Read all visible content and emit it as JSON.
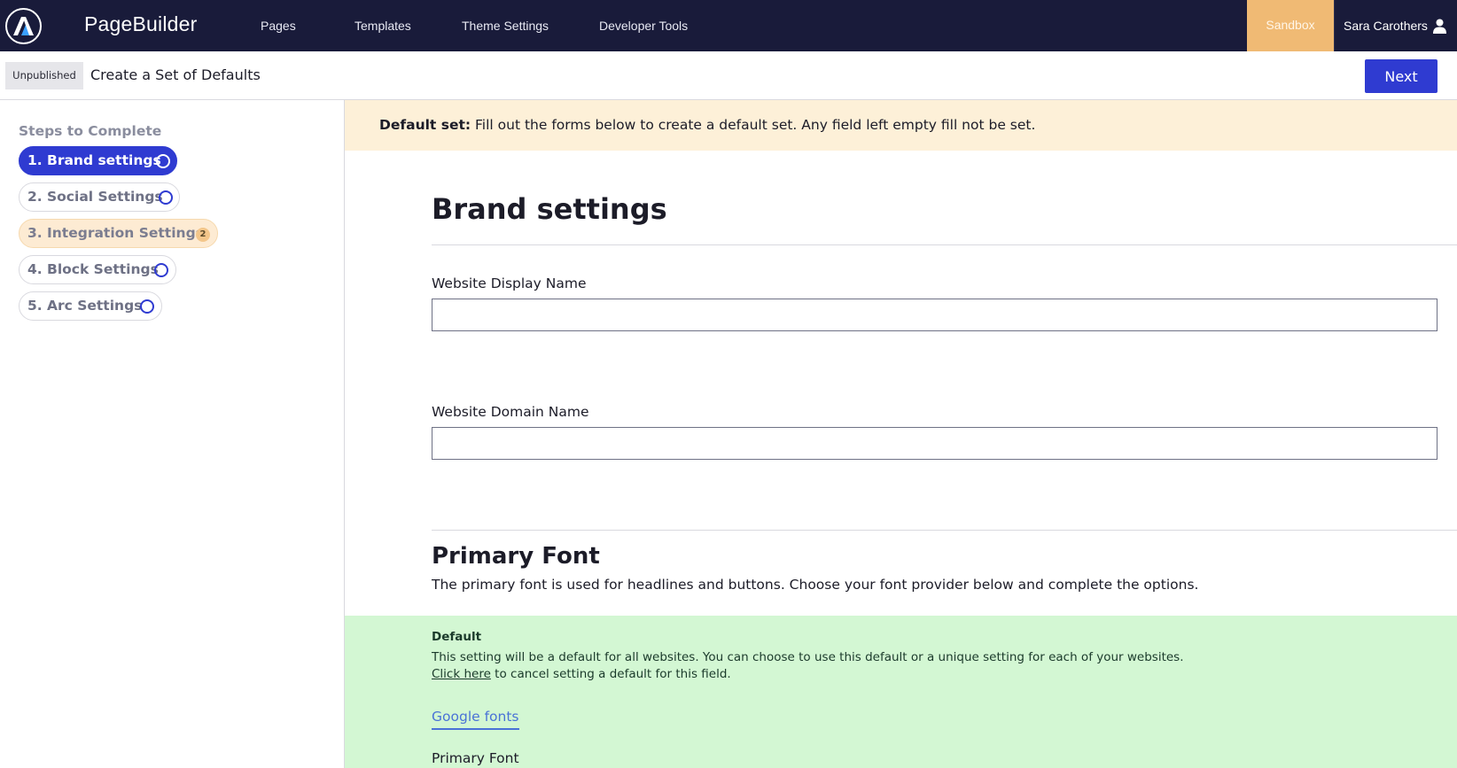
{
  "topbar": {
    "brand": "PageBuilder",
    "nav": [
      "Pages",
      "Templates",
      "Theme Settings",
      "Developer Tools"
    ],
    "environment": "Sandbox",
    "user_name": "Sara Carothers"
  },
  "subbar": {
    "status_badge": "Unpublished",
    "title": "Create a Set of Defaults",
    "next_label": "Next"
  },
  "sidebar": {
    "heading": "Steps to Complete",
    "steps": [
      {
        "num": "1.",
        "label": "Brand settings",
        "state": "active"
      },
      {
        "num": "2.",
        "label": "Social Settings",
        "state": "incomplete"
      },
      {
        "num": "3.",
        "label": "Integration Settings",
        "state": "warning",
        "count": "2"
      },
      {
        "num": "4.",
        "label": "Block Settings",
        "state": "incomplete"
      },
      {
        "num": "5.",
        "label": "Arc Settings",
        "state": "incomplete"
      }
    ]
  },
  "notice": {
    "bold": "Default set:",
    "text": " Fill out the forms below to create a default set. Any field left empty fill not be set."
  },
  "form": {
    "section_title": "Brand settings",
    "display_name_label": "Website Display Name",
    "display_name_value": "",
    "domain_name_label": "Website Domain Name",
    "domain_name_value": "",
    "font_title": "Primary Font",
    "font_desc": "The primary font is used for headlines and buttons. Choose your font provider below and complete the options."
  },
  "default_box": {
    "title": "Default",
    "desc": "This setting will be a default for all websites. You can choose to use this default or a unique setting for each of your websites.",
    "cancel_link": "Click here",
    "cancel_rest": " to cancel setting a default for this field.",
    "tab": "Google fonts",
    "field_label": "Primary Font"
  },
  "colors": {
    "nav_bg": "#191b3a",
    "accent": "#2f3bd1",
    "sandbox": "#f0ba74",
    "notice_bg": "#fdf0d8",
    "default_bg": "#d3f7d3"
  }
}
